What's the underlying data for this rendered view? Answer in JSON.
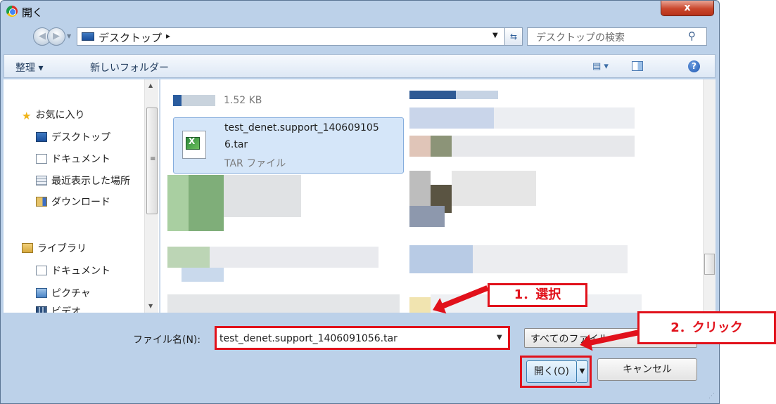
{
  "window": {
    "title": "開く",
    "close_label": "x"
  },
  "address": {
    "location": "デスクトップ",
    "separator": "▸",
    "search_placeholder": "デスクトップの検索"
  },
  "toolbar": {
    "organize": "整理 ▾",
    "new_folder": "新しいフォルダー",
    "views": "▤ ▾",
    "help": "?"
  },
  "nav": {
    "favorites": "お気に入り",
    "items": [
      {
        "label": "デスクトップ",
        "icon": "desktop-icon"
      },
      {
        "label": "ドキュメント",
        "icon": "document-icon"
      },
      {
        "label": "最近表示した場所",
        "icon": "recent-places-icon"
      },
      {
        "label": "ダウンロード",
        "icon": "download-icon"
      }
    ],
    "libraries": "ライブラリ",
    "library_items": [
      {
        "label": "ドキュメント",
        "icon": "document-icon"
      },
      {
        "label": "ピクチャ",
        "icon": "picture-icon"
      },
      {
        "label": "ビデオ",
        "icon": "video-icon"
      }
    ]
  },
  "files": {
    "previous_size": "1.52 KB",
    "selected": {
      "name_line1": "test_denet.support_140609105",
      "name_line2": "6.tar",
      "type": "TAR ファイル"
    }
  },
  "bottom": {
    "filename_label": "ファイル名(N):",
    "filename_value": "test_denet.support_1406091056.tar",
    "filter_value": "すべてのファイル",
    "open_label": "開く(O)",
    "cancel_label": "キャンセル"
  },
  "annotations": {
    "step1": "1．選択",
    "step2": "2．クリック"
  },
  "colors": {
    "annotation": "#e1111b",
    "selection": "#d5e6f9",
    "window_chrome": "#bcd1e9"
  }
}
